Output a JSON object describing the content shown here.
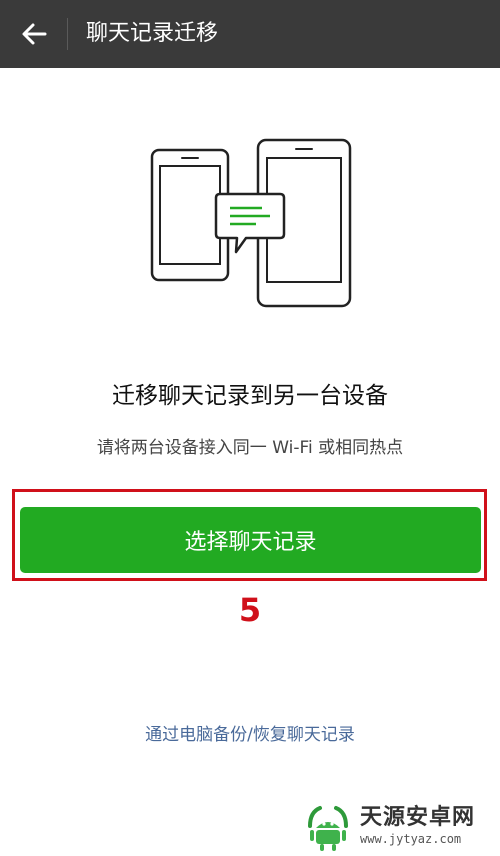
{
  "header": {
    "title": "聊天记录迁移",
    "back_icon": "arrow-left-icon"
  },
  "illustration": {
    "icon": "phones-transfer-icon",
    "accent_color": "#22aa22"
  },
  "main": {
    "heading": "迁移聊天记录到另一台设备",
    "subtext": "请将两台设备接入同一 Wi-Fi 或相同热点",
    "primary_button_label": "选择聊天记录",
    "step_number": "5",
    "pc_link": "通过电脑备份/恢复聊天记录"
  },
  "watermark": {
    "title": "天源安卓网",
    "url": "www.jytyaz.com"
  },
  "colors": {
    "topbar": "#3a3a3a",
    "primary": "#22aa22",
    "highlight": "#d0101a",
    "link": "#4a6a9a"
  }
}
